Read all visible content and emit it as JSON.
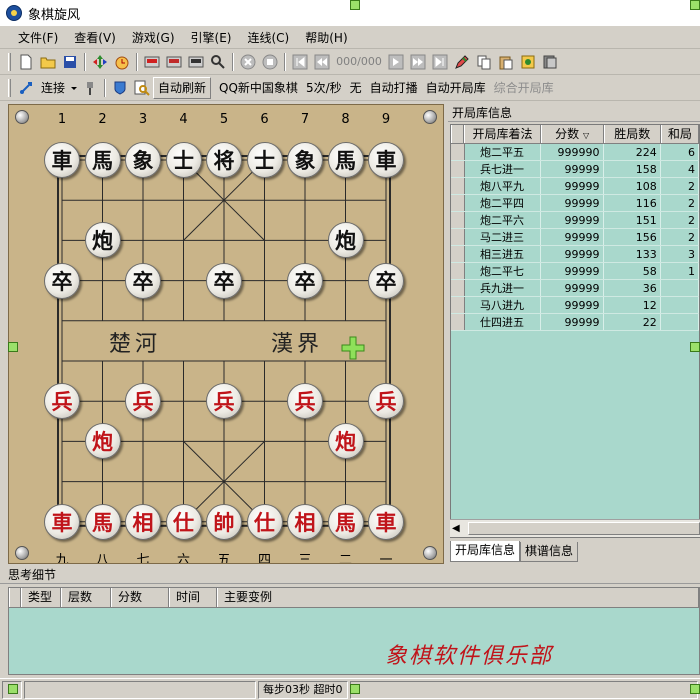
{
  "window": {
    "title": "象棋旋风"
  },
  "menu": [
    {
      "label": "文件(F)"
    },
    {
      "label": "查看(V)"
    },
    {
      "label": "游戏(G)"
    },
    {
      "label": "引擎(E)"
    },
    {
      "label": "连线(C)"
    },
    {
      "label": "帮助(H)"
    }
  ],
  "toolbar1": {
    "buttons": [
      "new-file-icon",
      "open-folder-icon",
      "save-disk-icon",
      "flip-board-icon",
      "alarm-clock-icon",
      "red-engine-icon",
      "black-engine-icon",
      "stop-engine-icon",
      "analyze-icon",
      "cancel-icon",
      "stop-icon"
    ],
    "page_text": "000/000",
    "nav": [
      "first-move-icon",
      "prev-move-icon",
      "next-move-icon",
      "last-move-icon",
      "end-icon"
    ],
    "extra": [
      "pencil-icon",
      "copy-icon",
      "paste-icon",
      "book-icon",
      "library-icon"
    ]
  },
  "toolbar2": {
    "connect_label": "连接",
    "auto_refresh": "自动刷新",
    "platform": "QQ新中国象棋",
    "speed": "5次/秒",
    "status": "无",
    "auto_play": "自动打播",
    "auto_opening": "自动开局库",
    "combined_opening": "综合开局库"
  },
  "board": {
    "top_labels": [
      "1",
      "2",
      "3",
      "4",
      "5",
      "6",
      "7",
      "8",
      "9"
    ],
    "bottom_labels": [
      "九",
      "八",
      "七",
      "六",
      "五",
      "四",
      "三",
      "二",
      "一"
    ],
    "river_left": "楚河",
    "river_right": "漢界",
    "pieces": [
      {
        "c": "车",
        "col": 0,
        "row": 0,
        "side": "black",
        "t": "車"
      },
      {
        "c": "马",
        "col": 1,
        "row": 0,
        "side": "black",
        "t": "馬"
      },
      {
        "c": "象",
        "col": 2,
        "row": 0,
        "side": "black",
        "t": "象"
      },
      {
        "c": "士",
        "col": 3,
        "row": 0,
        "side": "black",
        "t": "士"
      },
      {
        "c": "将",
        "col": 4,
        "row": 0,
        "side": "black",
        "t": "将"
      },
      {
        "c": "士",
        "col": 5,
        "row": 0,
        "side": "black",
        "t": "士"
      },
      {
        "c": "象",
        "col": 6,
        "row": 0,
        "side": "black",
        "t": "象"
      },
      {
        "c": "马",
        "col": 7,
        "row": 0,
        "side": "black",
        "t": "馬"
      },
      {
        "c": "车",
        "col": 8,
        "row": 0,
        "side": "black",
        "t": "車"
      },
      {
        "c": "炮",
        "col": 1,
        "row": 2,
        "side": "black",
        "t": "炮"
      },
      {
        "c": "炮",
        "col": 7,
        "row": 2,
        "side": "black",
        "t": "炮"
      },
      {
        "c": "卒",
        "col": 0,
        "row": 3,
        "side": "black",
        "t": "卒"
      },
      {
        "c": "卒",
        "col": 2,
        "row": 3,
        "side": "black",
        "t": "卒"
      },
      {
        "c": "卒",
        "col": 4,
        "row": 3,
        "side": "black",
        "t": "卒"
      },
      {
        "c": "卒",
        "col": 6,
        "row": 3,
        "side": "black",
        "t": "卒"
      },
      {
        "c": "卒",
        "col": 8,
        "row": 3,
        "side": "black",
        "t": "卒"
      },
      {
        "c": "兵",
        "col": 0,
        "row": 6,
        "side": "red",
        "t": "兵"
      },
      {
        "c": "兵",
        "col": 2,
        "row": 6,
        "side": "red",
        "t": "兵"
      },
      {
        "c": "兵",
        "col": 4,
        "row": 6,
        "side": "red",
        "t": "兵"
      },
      {
        "c": "兵",
        "col": 6,
        "row": 6,
        "side": "red",
        "t": "兵"
      },
      {
        "c": "兵",
        "col": 8,
        "row": 6,
        "side": "red",
        "t": "兵"
      },
      {
        "c": "炮",
        "col": 1,
        "row": 7,
        "side": "red",
        "t": "炮"
      },
      {
        "c": "炮",
        "col": 7,
        "row": 7,
        "side": "red",
        "t": "炮"
      },
      {
        "c": "车",
        "col": 0,
        "row": 9,
        "side": "red",
        "t": "車"
      },
      {
        "c": "马",
        "col": 1,
        "row": 9,
        "side": "red",
        "t": "馬"
      },
      {
        "c": "相",
        "col": 2,
        "row": 9,
        "side": "red",
        "t": "相"
      },
      {
        "c": "仕",
        "col": 3,
        "row": 9,
        "side": "red",
        "t": "仕"
      },
      {
        "c": "帅",
        "col": 4,
        "row": 9,
        "side": "red",
        "t": "帥"
      },
      {
        "c": "仕",
        "col": 5,
        "row": 9,
        "side": "red",
        "t": "仕"
      },
      {
        "c": "相",
        "col": 6,
        "row": 9,
        "side": "red",
        "t": "相"
      },
      {
        "c": "马",
        "col": 7,
        "row": 9,
        "side": "red",
        "t": "馬"
      },
      {
        "c": "车",
        "col": 8,
        "row": 9,
        "side": "red",
        "t": "車"
      }
    ]
  },
  "opening_book": {
    "title": "开局库信息",
    "columns": [
      "开局库着法",
      "分数",
      "胜局数",
      "和局"
    ],
    "rows": [
      [
        "炮二平五",
        "999990",
        "224",
        "6"
      ],
      [
        "兵七进一",
        "99999",
        "158",
        "4"
      ],
      [
        "炮八平九",
        "99999",
        "108",
        "2"
      ],
      [
        "炮二平四",
        "99999",
        "116",
        "2"
      ],
      [
        "炮二平六",
        "99999",
        "151",
        "2"
      ],
      [
        "马二进三",
        "99999",
        "156",
        "2"
      ],
      [
        "相三进五",
        "99999",
        "133",
        "3"
      ],
      [
        "炮二平七",
        "99999",
        "58",
        "1"
      ],
      [
        "兵九进一",
        "99999",
        "36",
        ""
      ],
      [
        "马八进九",
        "99999",
        "12",
        ""
      ],
      [
        "仕四进五",
        "99999",
        "22",
        ""
      ]
    ],
    "tabs": [
      "开局库信息",
      "棋谱信息"
    ]
  },
  "thinking": {
    "title": "思考细节",
    "columns": [
      "类型",
      "层数",
      "分数",
      "时间",
      "主要变例"
    ],
    "watermark": "象棋软件俱乐部"
  },
  "status": {
    "time": "每步03秒  超时0"
  }
}
